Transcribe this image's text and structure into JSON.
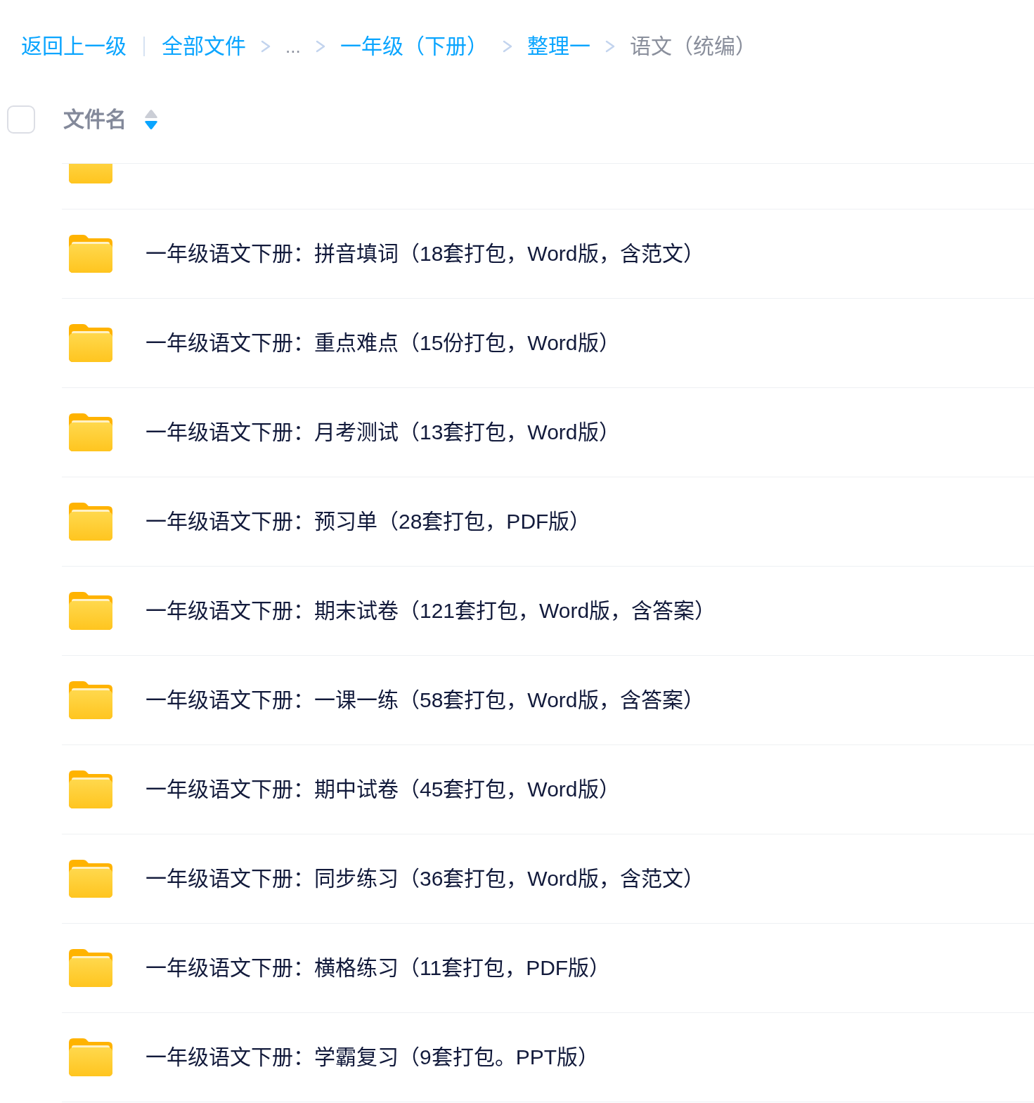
{
  "breadcrumb": [
    {
      "label": "返回上一级",
      "kind": "back"
    },
    {
      "label": "全部文件",
      "kind": "link"
    },
    {
      "label": "...",
      "kind": "ellipsis"
    },
    {
      "label": "一年级（下册）",
      "kind": "link"
    },
    {
      "label": "整理一",
      "kind": "link"
    },
    {
      "label": "语文（统编）",
      "kind": "current"
    }
  ],
  "header": {
    "checked": false,
    "label": "文件名",
    "sorted_descending": true
  },
  "partial_row_above": true,
  "files": [
    {
      "name": "一年级语文下册：拼音填词（18套打包，Word版，含范文）"
    },
    {
      "name": "一年级语文下册：重点难点（15份打包，Word版）"
    },
    {
      "name": "一年级语文下册：月考测试（13套打包，Word版）"
    },
    {
      "name": "一年级语文下册：预习单（28套打包，PDF版）"
    },
    {
      "name": "一年级语文下册：期末试卷（121套打包，Word版，含答案）"
    },
    {
      "name": "一年级语文下册：一课一练（58套打包，Word版，含答案）"
    },
    {
      "name": "一年级语文下册：期中试卷（45套打包，Word版）"
    },
    {
      "name": "一年级语文下册：同步练习（36套打包，Word版，含范文）"
    },
    {
      "name": "一年级语文下册：横格练习（11套打包，PDF版）"
    },
    {
      "name": "一年级语文下册：学霸复习（9套打包。PPT版）"
    }
  ]
}
